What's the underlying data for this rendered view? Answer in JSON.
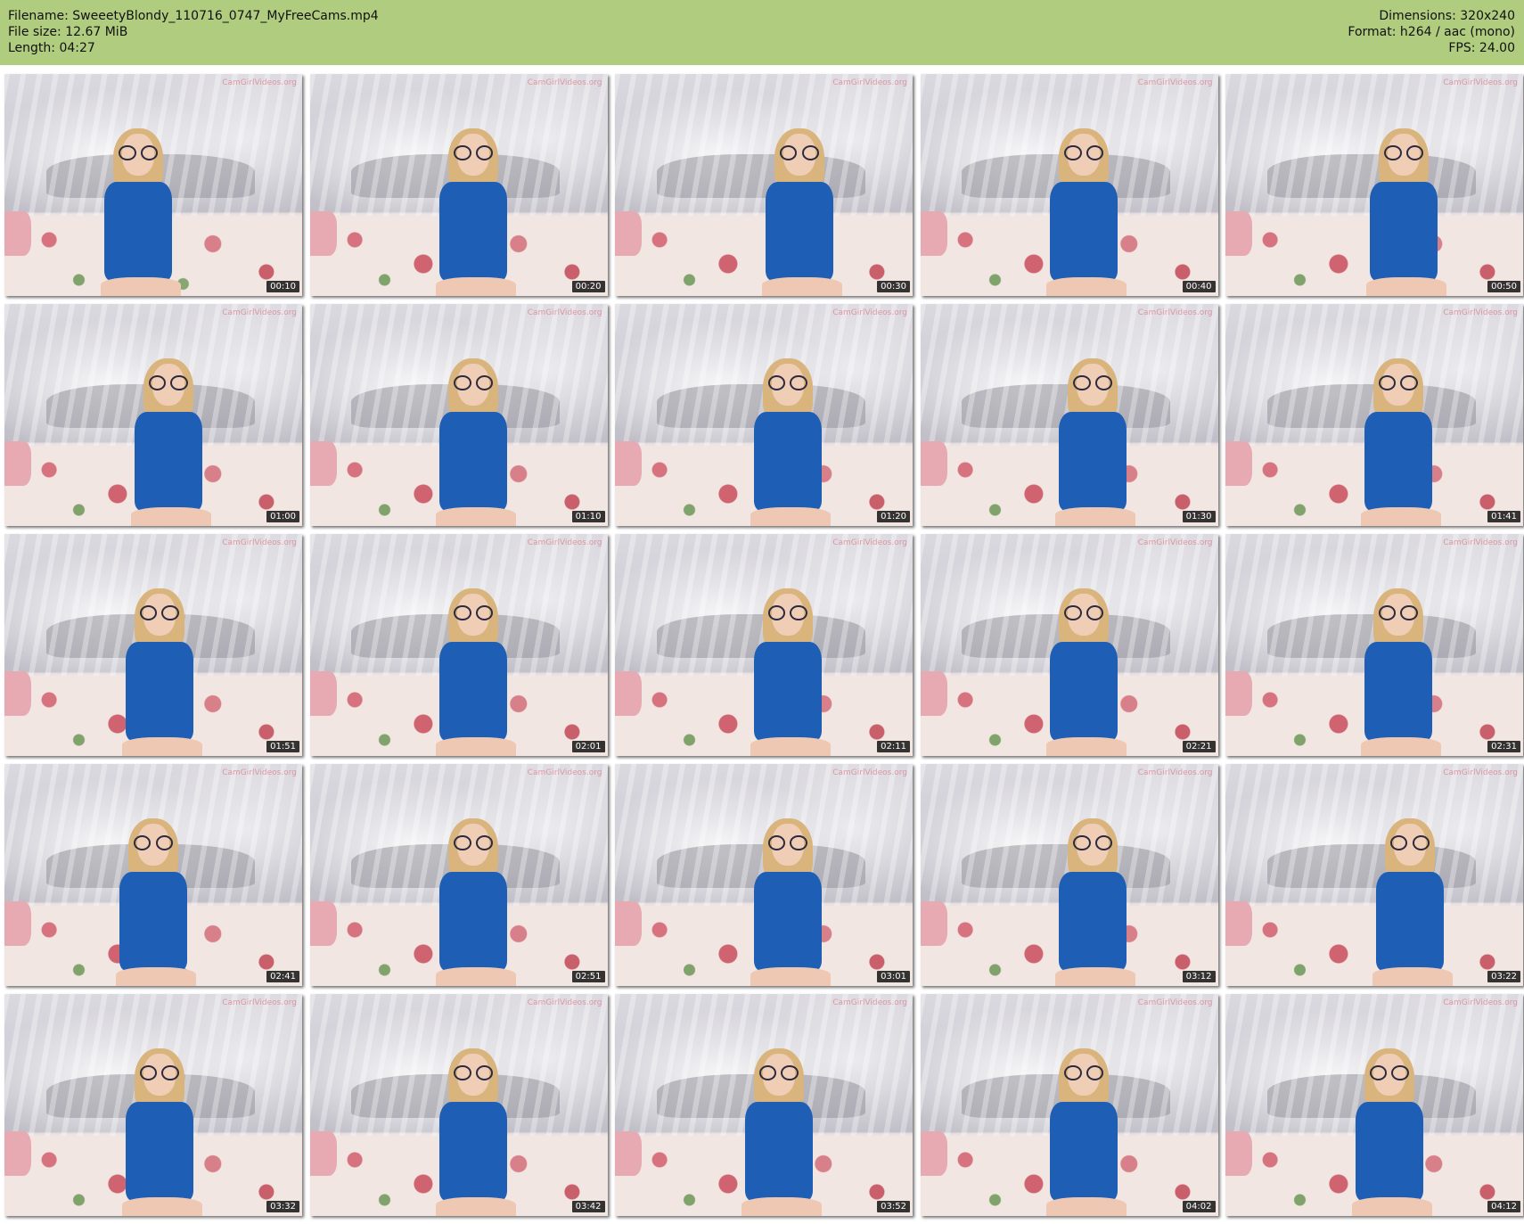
{
  "header": {
    "filename": "Filename: SweeetyBlondy_110716_0747_MyFreeCams.mp4",
    "filesize": "File size: 12.67 MiB",
    "length": "Length: 04:27",
    "dimensions": "Dimensions: 320x240",
    "format": "Format: h264 / aac (mono)",
    "fps": "FPS: 24.00",
    "background_color": "#b0cc7e"
  },
  "grid": {
    "columns": 5,
    "rows": 5,
    "watermark_text": "CamGirlVideos.org",
    "timestamps": [
      "00:10",
      "00:20",
      "00:30",
      "00:40",
      "00:50",
      "01:00",
      "01:10",
      "01:20",
      "01:30",
      "01:41",
      "01:51",
      "02:01",
      "02:11",
      "02:21",
      "02:31",
      "02:41",
      "02:51",
      "03:01",
      "03:12",
      "03:22",
      "03:32",
      "03:42",
      "03:52",
      "04:02",
      "04:12"
    ],
    "person_position": [
      0.45,
      0.55,
      0.62,
      0.55,
      0.6,
      0.55,
      0.55,
      0.58,
      0.58,
      0.58,
      0.52,
      0.55,
      0.58,
      0.55,
      0.58,
      0.5,
      0.55,
      0.58,
      0.58,
      0.62,
      0.52,
      0.55,
      0.55,
      0.55,
      0.55
    ]
  }
}
